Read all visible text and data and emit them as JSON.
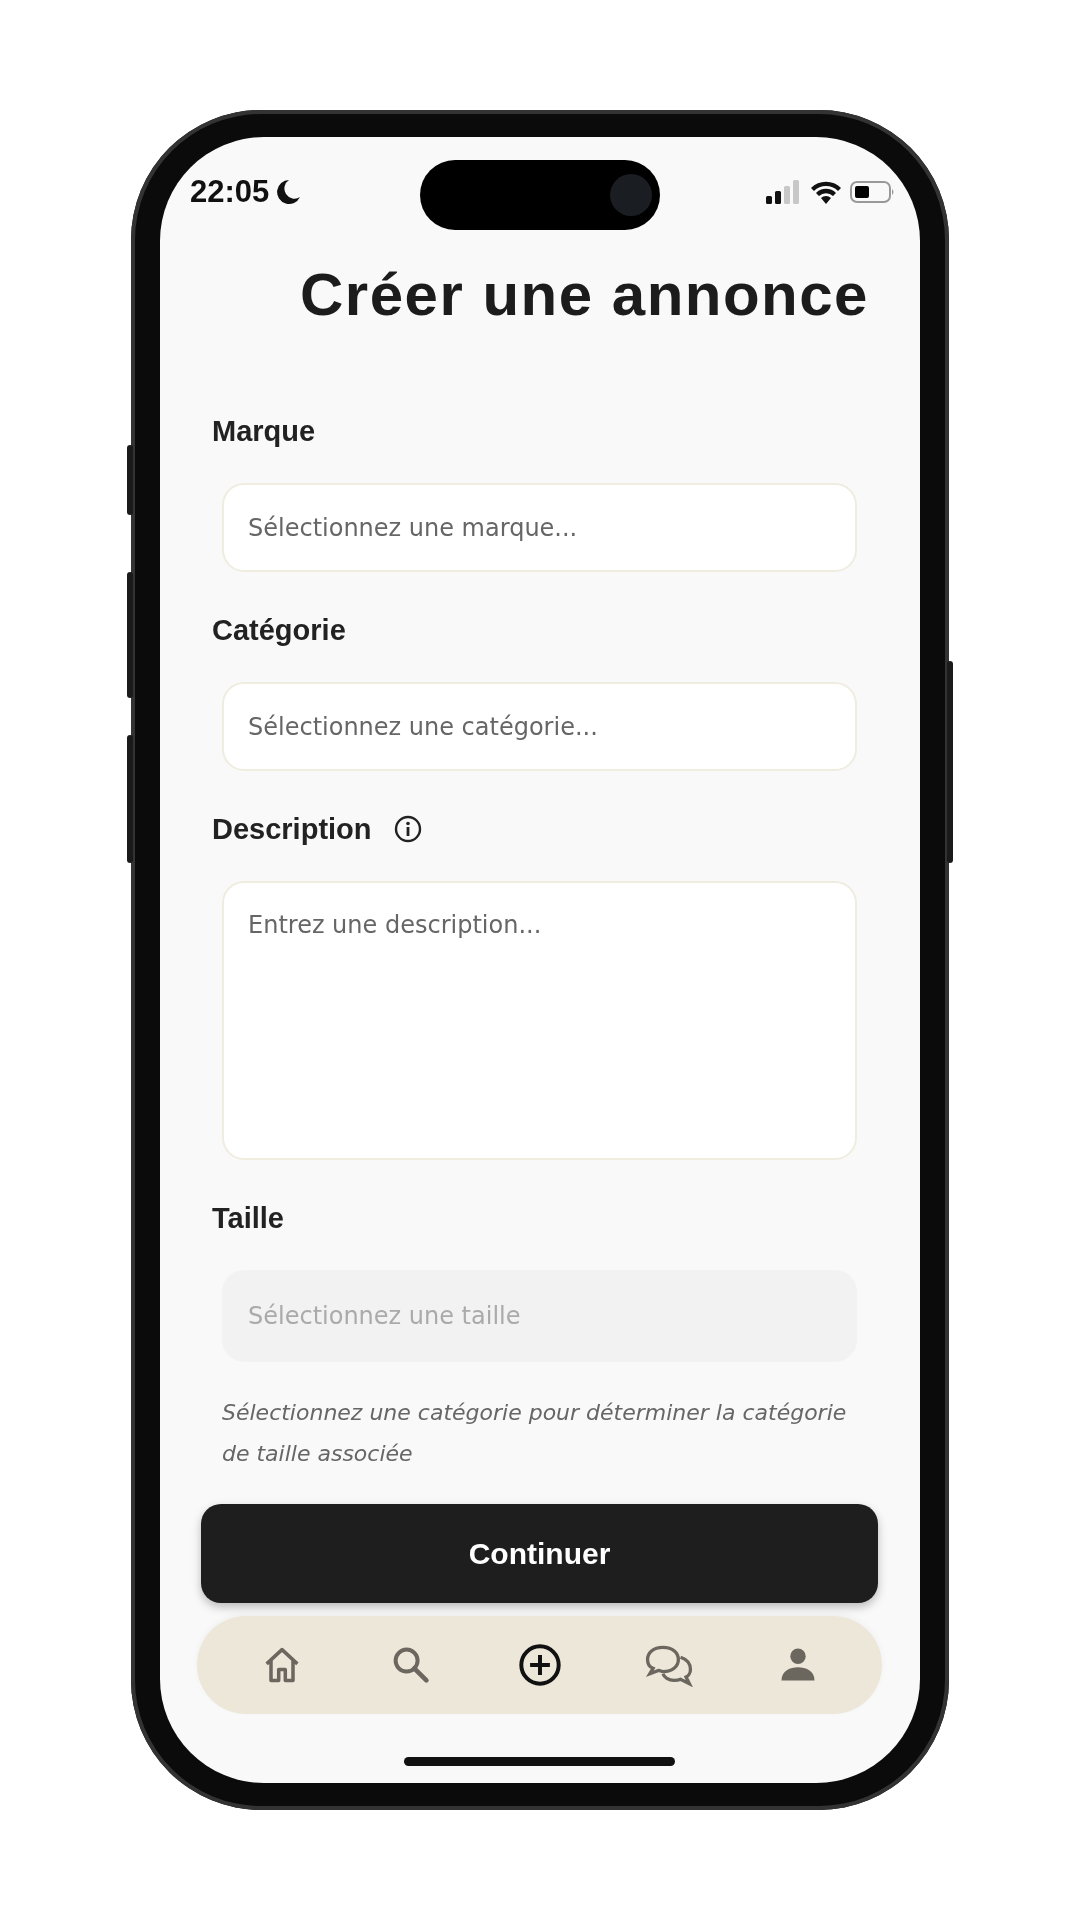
{
  "status_bar": {
    "time": "22:05"
  },
  "title": "Créer une annonce",
  "fields": [
    {
      "kind": "select",
      "label": "Marque",
      "info": false,
      "placeholder": "Sélectionnez une marque...",
      "disabled": false
    },
    {
      "kind": "select",
      "label": "Catégorie",
      "info": false,
      "placeholder": "Sélectionnez une catégorie...",
      "disabled": false
    },
    {
      "kind": "textarea",
      "label": "Description",
      "info": true,
      "placeholder": "Entrez une description...",
      "disabled": false
    },
    {
      "kind": "select",
      "label": "Taille",
      "info": false,
      "placeholder": "Sélectionnez une taille",
      "disabled": true,
      "hint": "Sélectionnez une catégorie pour déterminer la catégorie de taille associée"
    }
  ],
  "continue_button": {
    "label": "Continuer"
  },
  "nav": [
    {
      "selected": false
    },
    {
      "selected": false
    },
    {
      "selected": true
    },
    {
      "selected": false
    },
    {
      "selected": false
    }
  ]
}
